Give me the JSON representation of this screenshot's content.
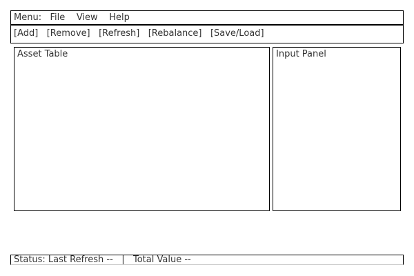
{
  "menubar": {
    "prefix": "Menu:",
    "items": [
      {
        "label": "File"
      },
      {
        "label": "View"
      },
      {
        "label": "Help"
      }
    ]
  },
  "toolbar": {
    "buttons": [
      {
        "label": "[Add]"
      },
      {
        "label": "[Remove]"
      },
      {
        "label": "[Refresh]"
      },
      {
        "label": "[Rebalance]"
      },
      {
        "label": "[Save/Load]"
      }
    ]
  },
  "asset_table": {
    "title": "Asset Table"
  },
  "input_panel": {
    "title": "Input Panel"
  },
  "statusbar": {
    "last_refresh": "Status: Last Refresh --",
    "separator": "|",
    "total_value": "Total Value --"
  }
}
